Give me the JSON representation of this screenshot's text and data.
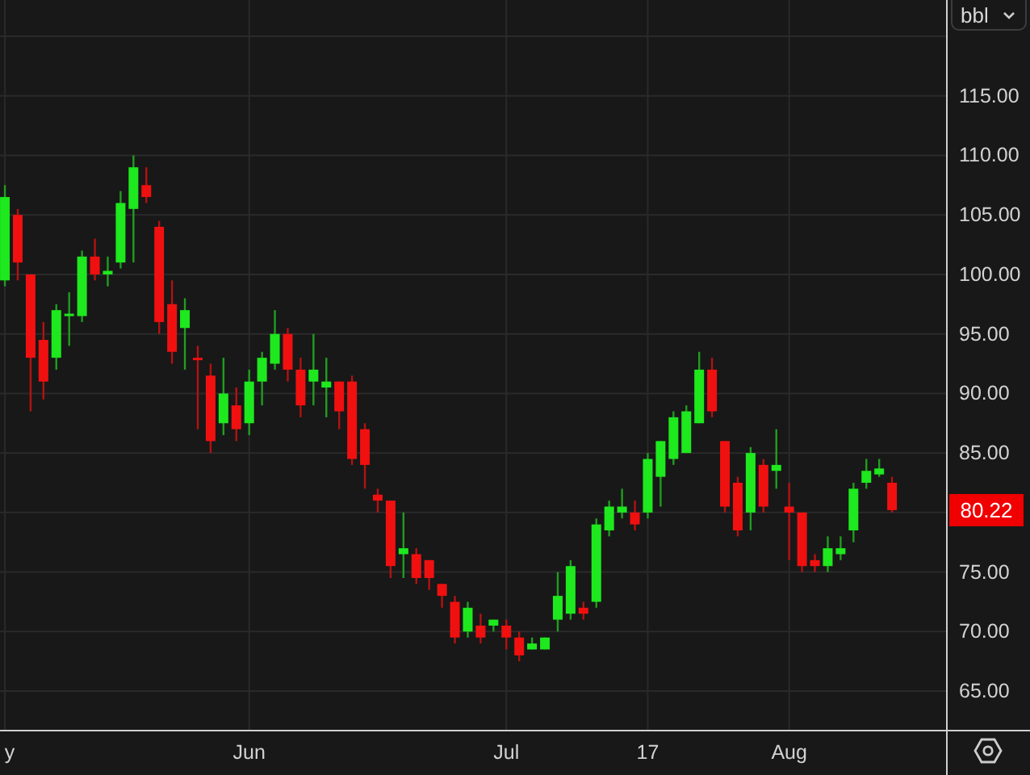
{
  "unit_selector": {
    "label": "bbl"
  },
  "chart": {
    "last_price_label": "80.22",
    "chart_data": {
      "type": "candlestick",
      "grid": true,
      "ylim": [
        61.75,
        123.05
      ],
      "categories": [
        "y",
        null,
        null,
        null,
        null,
        null,
        null,
        null,
        null,
        null,
        null,
        null,
        null,
        null,
        null,
        null,
        null,
        null,
        null,
        "Jun",
        null,
        null,
        null,
        null,
        null,
        null,
        null,
        null,
        null,
        null,
        null,
        null,
        null,
        null,
        null,
        null,
        null,
        null,
        null,
        "Jul",
        null,
        null,
        null,
        null,
        null,
        null,
        null,
        null,
        null,
        null,
        "17",
        null,
        null,
        null,
        null,
        null,
        null,
        null,
        null,
        null,
        null,
        "Aug",
        null,
        null,
        null,
        null,
        null,
        null,
        null,
        null
      ],
      "yticks": [
        {
          "value": 65,
          "label": "65.00"
        },
        {
          "value": 70,
          "label": "70.00"
        },
        {
          "value": 75,
          "label": "75.00"
        },
        {
          "value": 85,
          "label": "85.00"
        },
        {
          "value": 90,
          "label": "90.00"
        },
        {
          "value": 95,
          "label": "95.00"
        },
        {
          "value": 100,
          "label": "100.00"
        },
        {
          "value": 105,
          "label": "105.00"
        },
        {
          "value": 110,
          "label": "110.00"
        },
        {
          "value": 115,
          "label": "115.00"
        }
      ],
      "ohlc": [
        [
          99.5,
          107.5,
          99,
          106.5
        ],
        [
          105,
          105.5,
          99.5,
          101
        ],
        [
          100,
          100,
          88.5,
          93
        ],
        [
          94.5,
          96,
          89.5,
          91
        ],
        [
          93,
          97.5,
          92,
          97
        ],
        [
          96.5,
          98.5,
          94,
          96.7
        ],
        [
          96.5,
          102,
          96,
          101.5
        ],
        [
          101.5,
          103,
          99.5,
          100
        ],
        [
          100,
          101.5,
          99,
          100.3
        ],
        [
          101,
          107,
          100.5,
          106
        ],
        [
          105.5,
          110,
          101,
          109
        ],
        [
          107.5,
          109,
          106,
          106.5
        ],
        [
          104,
          104.5,
          95,
          96
        ],
        [
          97.5,
          99.5,
          92.5,
          93.5
        ],
        [
          95.5,
          98,
          92,
          97
        ],
        [
          93,
          94,
          87,
          92.9
        ],
        [
          91.5,
          92.5,
          85,
          86
        ],
        [
          87.5,
          93,
          86.5,
          90
        ],
        [
          89,
          90.5,
          86,
          87
        ],
        [
          87.5,
          92,
          86.5,
          91
        ],
        [
          91,
          93.5,
          89,
          93
        ],
        [
          92.5,
          97,
          92,
          95
        ],
        [
          95,
          95.5,
          91,
          92
        ],
        [
          92,
          93,
          88,
          89
        ],
        [
          91,
          95,
          89,
          92
        ],
        [
          90.5,
          93,
          88,
          91
        ],
        [
          91,
          91,
          87,
          88.5
        ],
        [
          91,
          91.5,
          84,
          84.5
        ],
        [
          87,
          87.5,
          82,
          84
        ],
        [
          81.5,
          82,
          80,
          81
        ],
        [
          81,
          81,
          74.5,
          75.5
        ],
        [
          76.5,
          80,
          74.5,
          77
        ],
        [
          76.5,
          77,
          74,
          74.5
        ],
        [
          76,
          76,
          73.5,
          74.5
        ],
        [
          74,
          74,
          72,
          73
        ],
        [
          72.5,
          73,
          69,
          69.5
        ],
        [
          70,
          72.5,
          69.5,
          72
        ],
        [
          70.5,
          71.5,
          69,
          69.5
        ],
        [
          70.5,
          71,
          70,
          71
        ],
        [
          70.5,
          71,
          68.5,
          69.5
        ],
        [
          69.5,
          70,
          67.5,
          68
        ],
        [
          68.5,
          69.5,
          68.5,
          69
        ],
        [
          68.5,
          69.5,
          68.5,
          69.5
        ],
        [
          71,
          75,
          70,
          73
        ],
        [
          71.5,
          76,
          71,
          75.5
        ],
        [
          72,
          72.5,
          71,
          71.5
        ],
        [
          72.5,
          79.5,
          72,
          79
        ],
        [
          78.5,
          81,
          78,
          80.5
        ],
        [
          80,
          82,
          79.5,
          80.5
        ],
        [
          80,
          81,
          78.5,
          79
        ],
        [
          80,
          85,
          79.5,
          84.5
        ],
        [
          83,
          86,
          80.5,
          86
        ],
        [
          84.5,
          88.5,
          84,
          88
        ],
        [
          85,
          89,
          85,
          88.5
        ],
        [
          87.5,
          93.5,
          87.5,
          92
        ],
        [
          92,
          93,
          88,
          88.5
        ],
        [
          86,
          86,
          80,
          80.5
        ],
        [
          82.5,
          83,
          78,
          78.5
        ],
        [
          80,
          85.5,
          78.5,
          85
        ],
        [
          84,
          84.5,
          80,
          80.5
        ],
        [
          83.5,
          87,
          82,
          84
        ],
        [
          80.5,
          82.5,
          76,
          80
        ],
        [
          80,
          80,
          75,
          75.5
        ],
        [
          76,
          76.5,
          75,
          75.5
        ],
        [
          75.5,
          78,
          75,
          77
        ],
        [
          76.5,
          78,
          76,
          77
        ],
        [
          78.5,
          82.5,
          77.5,
          82
        ],
        [
          82.5,
          84.5,
          82,
          83.5
        ],
        [
          83.2,
          84.5,
          83,
          83.7
        ],
        [
          82.5,
          83,
          80,
          80.2
        ]
      ]
    }
  }
}
